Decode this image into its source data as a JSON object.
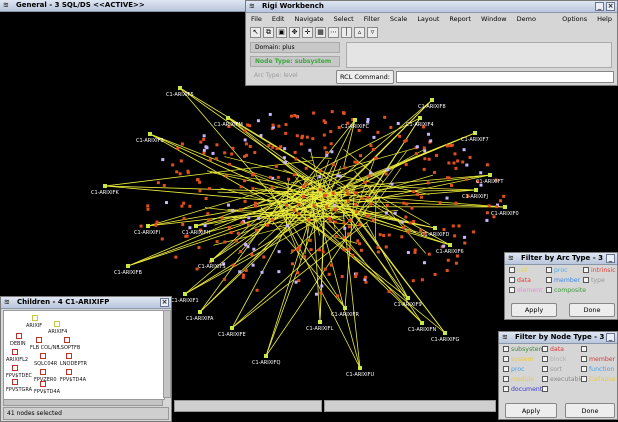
{
  "main_window": {
    "title": "General - 3 SQL/DS <<ACTIVE>>",
    "node_labels": [
      "C1-ARIXIF5",
      "C1-ARIXIFM",
      "C1-ARIXIF3",
      "C1-ARIXIFC",
      "C1-ARIXIF4",
      "C1-ARIXIF7",
      "C1-ARIXIF8",
      "C1-ARIXIFT",
      "C1-ARIXIFK",
      "C1-ARIXIFJ",
      "C1-ARIXIF0",
      "C1-ARIXIFI",
      "C1-ARIXIFH",
      "C1-ARIXIFD",
      "C1-ARIXIF6",
      "C1-ARIXIFB",
      "C1-ARIXIFS",
      "C1-ARIXIF1",
      "C1-ARIXIF9",
      "C1-ARIXIFA",
      "C1-ARIXIFE",
      "C1-ARIXIFL",
      "C1-ARIXIFR",
      "C1-ARIXIFN",
      "C1-ARIXIFG",
      "C1-ARIXIFQ",
      "C1-ARIXIFU"
    ]
  },
  "rigi_window": {
    "title": "Rigi Workbench",
    "menu": [
      "File",
      "Edit",
      "Navigate",
      "Select",
      "Filter",
      "Scale",
      "Layout",
      "Report",
      "Window",
      "Demo"
    ],
    "menu_right": [
      "Options",
      "Help"
    ],
    "toolbar_icons": [
      "select-icon",
      "copy-icon",
      "paste-icon",
      "move-icon",
      "pan-icon",
      "grid-icon",
      "more-icon",
      "bar-icon",
      "up-icon",
      "down-icon"
    ],
    "domain_label": "Domain: plus",
    "node_type_label": "Node Type: subsystem",
    "arc_type_label": "Arc Type: level",
    "rcl_button": "RCL Command:",
    "rcl_value": ""
  },
  "arc_filter": {
    "title": "Filter by Arc Type - 3",
    "options": [
      {
        "label": "call",
        "color": "#e8d84a"
      },
      {
        "label": "proc",
        "color": "#4ab0e8"
      },
      {
        "label": "intrinsic",
        "color": "#e8403a"
      },
      {
        "label": "data",
        "color": "#e8403a"
      },
      {
        "label": "member",
        "color": "#3a8ae8"
      },
      {
        "label": "type",
        "color": "#9a9a9a"
      },
      {
        "label": "element",
        "color": "#e88ae0"
      },
      {
        "label": "composite",
        "color": "#3a9a3a"
      }
    ],
    "apply_label": "Apply",
    "done_label": "Done"
  },
  "node_filter": {
    "title": "Filter by Node Type - 3",
    "options": [
      {
        "label": "subsystem",
        "color": "#3a8a3a"
      },
      {
        "label": "data",
        "color": "#d83a3a"
      },
      {
        "label": "",
        "color": "#d83a3a"
      },
      {
        "label": "system",
        "color": "#e8c84a"
      },
      {
        "label": "block",
        "color": "#b0b0b0"
      },
      {
        "label": "member",
        "color": "#d83a3a"
      },
      {
        "label": "proc",
        "color": "#4aa0e8"
      },
      {
        "label": "sort",
        "color": "#9a9a9a"
      },
      {
        "label": "function",
        "color": "#4aa0e8"
      },
      {
        "label": "module",
        "color": "#e8c84a"
      },
      {
        "label": "executable",
        "color": "#888888"
      },
      {
        "label": "Collapse",
        "color": "#e8c84a"
      },
      {
        "label": "document",
        "color": "#3a3ad8"
      },
      {
        "label": "",
        "color": "#9ad89a"
      }
    ],
    "apply_label": "Apply",
    "done_label": "Done"
  },
  "children_window": {
    "title": "Children - 4 C1-ARIXIFP",
    "items": [
      "ARIXIF",
      "ARIXIF4",
      "DEBIN",
      "FLB COL/NF",
      "LSOPTFB",
      "ARIXIFL2",
      "SQLC04R",
      "LNODEPTR",
      "FPV$TDEC",
      "FPVZER0",
      "FPV$TD4A",
      "FPVSTGRA",
      "FPV$TD4A"
    ],
    "status": "41 nodes selected"
  },
  "colors": {
    "node_red": "#e0501e",
    "node_violet": "#c8b4ff",
    "node_green": "#c8e84a",
    "edge_yellow": "#ecec3c",
    "canvas": "#000000"
  }
}
